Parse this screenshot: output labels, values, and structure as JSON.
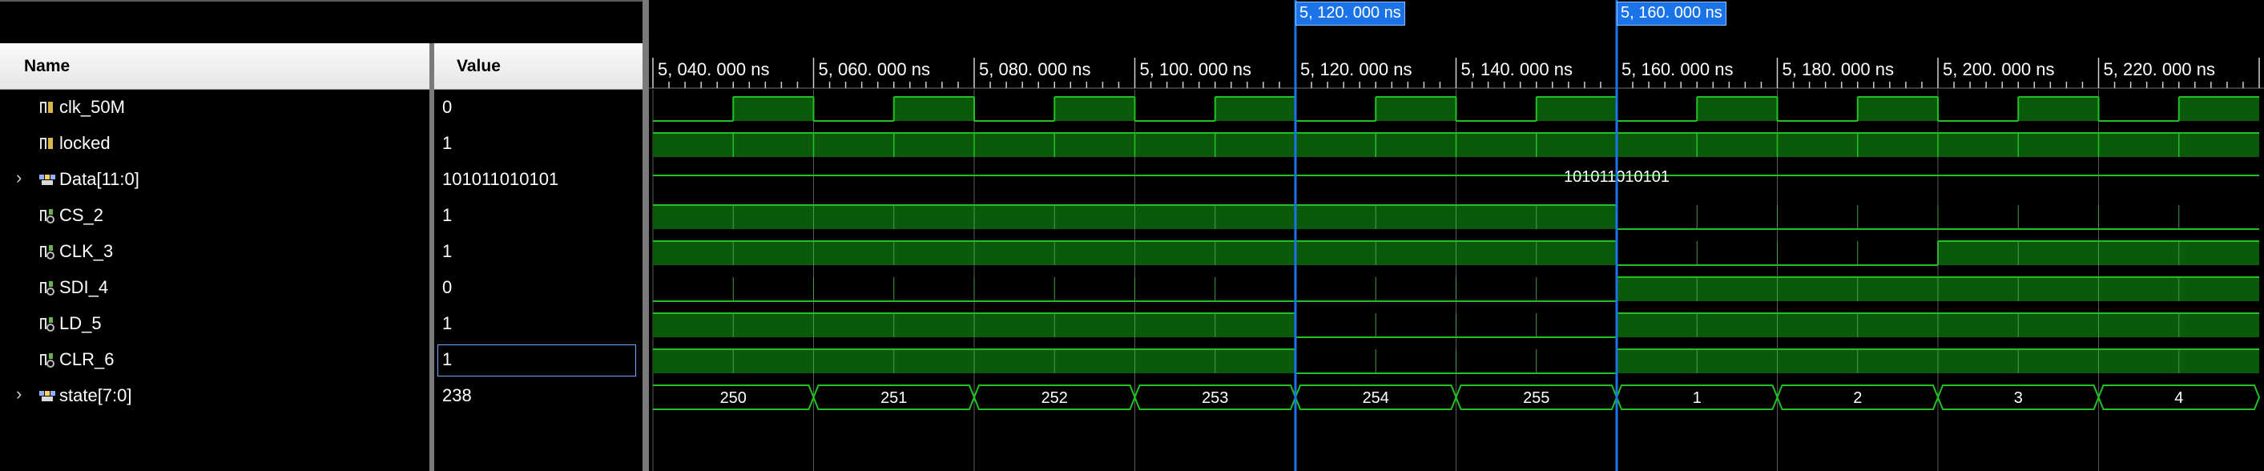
{
  "columns": {
    "name": "Name",
    "value": "Value"
  },
  "signals": [
    {
      "name": "clk_50M",
      "value": "0",
      "type": "bit",
      "icon": "signal-icon",
      "expandable": false
    },
    {
      "name": "locked",
      "value": "1",
      "type": "bit",
      "icon": "signal-icon",
      "expandable": false
    },
    {
      "name": "Data[11:0]",
      "value": "101011010101",
      "type": "bus",
      "icon": "bus-icon",
      "expandable": true
    },
    {
      "name": "CS_2",
      "value": "1",
      "type": "bit",
      "icon": "output-signal-icon",
      "expandable": false
    },
    {
      "name": "CLK_3",
      "value": "1",
      "type": "bit",
      "icon": "output-signal-icon",
      "expandable": false
    },
    {
      "name": "SDI_4",
      "value": "0",
      "type": "bit",
      "icon": "output-signal-icon",
      "expandable": false
    },
    {
      "name": "LD_5",
      "value": "1",
      "type": "bit",
      "icon": "output-signal-icon",
      "expandable": false
    },
    {
      "name": "CLR_6",
      "value": "1",
      "type": "bit",
      "icon": "output-signal-icon",
      "expandable": false,
      "selected": true
    },
    {
      "name": "state[7:0]",
      "value": "238",
      "type": "bus",
      "icon": "bus-icon",
      "expandable": true
    }
  ],
  "timeline": {
    "unit": "ns",
    "tick_labels": [
      "5, 040. 000 ns",
      "5, 060. 000 ns",
      "5, 080. 000 ns",
      "5, 100. 000 ns",
      "5, 120. 000 ns",
      "5, 140. 000 ns",
      "5, 160. 000 ns",
      "5, 180. 000 ns",
      "5, 200. 000 ns",
      "5, 220. 000 ns"
    ],
    "tick_times": [
      5040,
      5060,
      5080,
      5100,
      5120,
      5140,
      5160,
      5180,
      5200,
      5220
    ],
    "cursors": [
      {
        "label": "5, 120. 000 ns",
        "time": 5120
      },
      {
        "label": "5, 160. 000 ns",
        "time": 5160
      }
    ],
    "view_start": 5040,
    "view_end": 5240
  },
  "waves": {
    "clk_50M": {
      "kind": "clock",
      "period": 20,
      "first_rise": 5050
    },
    "locked": {
      "kind": "high"
    },
    "Data[11:0]": {
      "kind": "bus",
      "segments": [
        {
          "label": "101011010101",
          "start": 5040,
          "end": 5240
        }
      ]
    },
    "CS_2": {
      "kind": "levels",
      "changes": [
        [
          5040,
          1
        ],
        [
          5160,
          0
        ]
      ]
    },
    "CLK_3": {
      "kind": "levels",
      "changes": [
        [
          5040,
          1
        ],
        [
          5160,
          0
        ],
        [
          5200,
          1
        ]
      ]
    },
    "SDI_4": {
      "kind": "levels",
      "changes": [
        [
          5040,
          0
        ],
        [
          5160,
          1
        ]
      ]
    },
    "LD_5": {
      "kind": "levels",
      "changes": [
        [
          5040,
          1
        ],
        [
          5120,
          0
        ],
        [
          5160,
          1
        ]
      ]
    },
    "CLR_6": {
      "kind": "levels",
      "changes": [
        [
          5040,
          1
        ],
        [
          5120,
          0
        ],
        [
          5160,
          1
        ]
      ]
    },
    "state[7:0]": {
      "kind": "bus",
      "segments": [
        {
          "label": "250",
          "start": 5040,
          "end": 5060
        },
        {
          "label": "251",
          "start": 5060,
          "end": 5080
        },
        {
          "label": "252",
          "start": 5080,
          "end": 5100
        },
        {
          "label": "253",
          "start": 5100,
          "end": 5120
        },
        {
          "label": "254",
          "start": 5120,
          "end": 5140
        },
        {
          "label": "255",
          "start": 5140,
          "end": 5160
        },
        {
          "label": "1",
          "start": 5160,
          "end": 5180
        },
        {
          "label": "2",
          "start": 5180,
          "end": 5200
        },
        {
          "label": "3",
          "start": 5200,
          "end": 5220
        },
        {
          "label": "4",
          "start": 5220,
          "end": 5240
        }
      ]
    }
  },
  "colors": {
    "wave": "#22c022",
    "wave_fill": "#0b5a0b",
    "cursor": "#1a73e8",
    "grid": "#5a5a5a"
  }
}
